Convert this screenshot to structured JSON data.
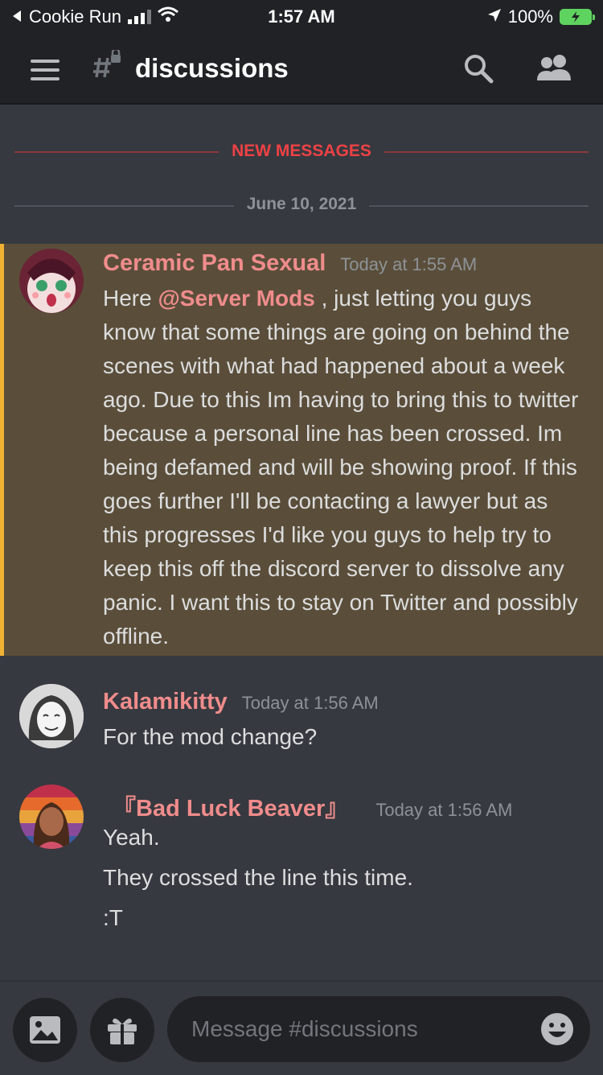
{
  "status_bar": {
    "carrier": "Cookie Run",
    "time": "1:57 AM",
    "battery": "100%"
  },
  "header": {
    "channel_name": "discussions"
  },
  "separators": {
    "new_messages": "NEW MESSAGES",
    "date": "June 10, 2021"
  },
  "messages": [
    {
      "author": "Ceramic Pan Sexual",
      "time": "Today at 1:55 AM",
      "text_before": "Here ",
      "mention": "@Server Mods",
      "text_after": " , just letting you guys know that some things are going on behind the scenes with what had happened about a week ago. Due to this Im having to bring this to twitter because a personal line has been crossed. Im being defamed and will be showing proof. If this goes further I'll be contacting a lawyer but as this progresses I'd like you guys to help try to keep this off the discord server to dissolve any panic. I want this to stay on Twitter and possibly offline."
    },
    {
      "author": "Kalamikitty",
      "time": "Today at 1:56 AM",
      "text": "For the mod change?"
    },
    {
      "author": "『Bad Luck Beaver』",
      "time": "Today at 1:56 AM",
      "lines": [
        "Yeah.",
        "They crossed the line this time.",
        ":T"
      ]
    }
  ],
  "composer": {
    "placeholder": "Message #discussions"
  },
  "colors": {
    "background": "#36393f",
    "header": "#202225",
    "accent_red": "#ed4245",
    "mention_highlight": "#5a4e3a",
    "author_color": "#f08c8c"
  },
  "icons": [
    "hamburger-icon",
    "channel-hash-icon",
    "search-icon",
    "members-icon",
    "image-icon",
    "gift-icon",
    "emoji-icon"
  ]
}
